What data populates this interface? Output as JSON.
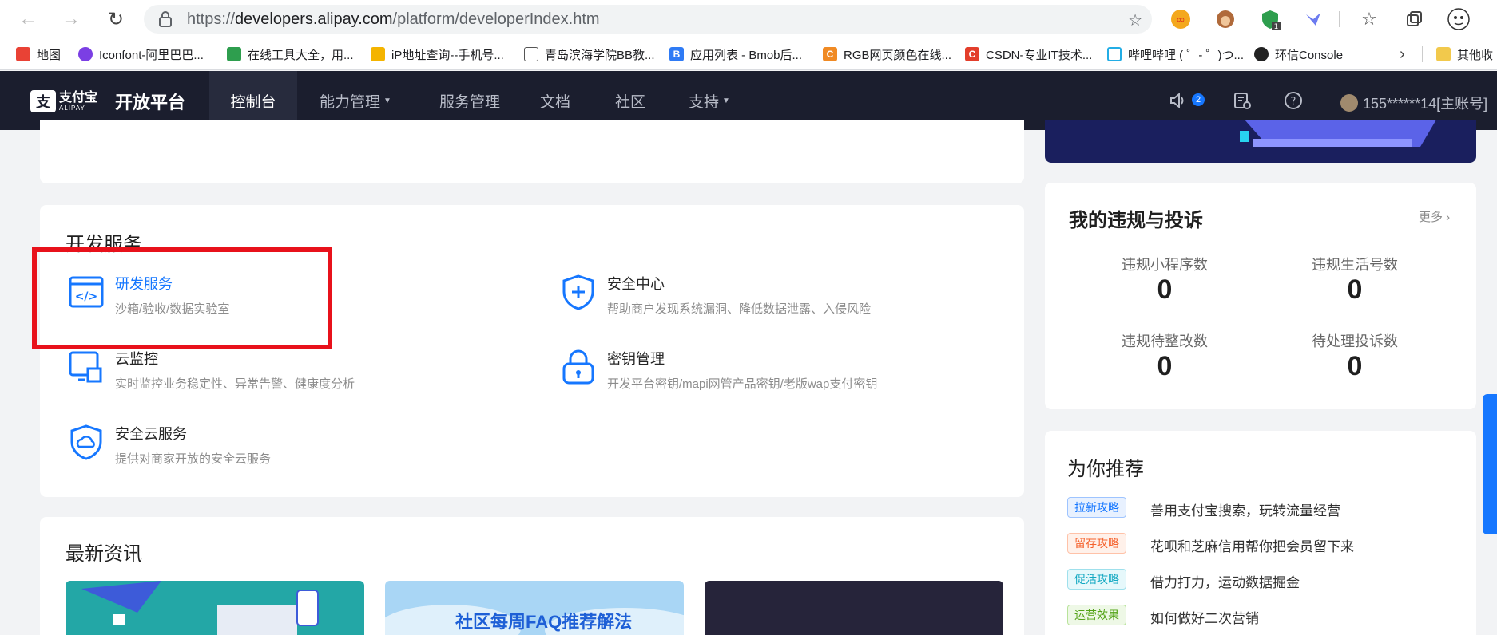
{
  "browser": {
    "url_scheme": "https://",
    "url_host": "developers.alipay.com",
    "url_path": "/platform/developerIndex.htm",
    "ext_badge": "1",
    "bookmarks": [
      {
        "label": "地图",
        "color": "#e94235"
      },
      {
        "label": "Iconfont-阿里巴巴...",
        "color": "#7b3fe4"
      },
      {
        "label": "在线工具大全，用...",
        "color": "#2e9e4e"
      },
      {
        "label": "iP地址查询--手机号...",
        "color": "#f4b400"
      },
      {
        "label": "青岛滨海学院BB教...",
        "color": "#888888"
      },
      {
        "label": "应用列表 - Bmob后...",
        "color": "#2f7bf5"
      },
      {
        "label": "RGB网页颜色在线...",
        "color": "#f08a24"
      },
      {
        "label": "CSDN-专业IT技术...",
        "color": "#e33e2b"
      },
      {
        "label": "哔哩哔哩 ( ゜- ゜)つ...",
        "color": "#23ade5"
      },
      {
        "label": "环信Console",
        "color": "#222222"
      },
      {
        "label": "其他收",
        "color": "#f2c94c"
      }
    ]
  },
  "header": {
    "logo_text": "支付宝",
    "logo_sub": "ALIPAY",
    "platform_title": "开放平台",
    "nav": [
      {
        "label": "控制台",
        "active": true
      },
      {
        "label": "能力管理",
        "caret": true
      },
      {
        "label": "服务管理"
      },
      {
        "label": "文档"
      },
      {
        "label": "社区"
      },
      {
        "label": "支持",
        "caret": true
      }
    ],
    "notification_count": "2",
    "user_label": "155******14[主账号]"
  },
  "dev_services": {
    "title": "开发服务",
    "items": [
      {
        "name": "研发服务",
        "desc": "沙箱/验收/数据实验室",
        "icon": "code-window-icon"
      },
      {
        "name": "安全中心",
        "desc": "帮助商户发现系统漏洞、降低数据泄露、入侵风险",
        "icon": "shield-plus-icon"
      },
      {
        "name": "云监控",
        "desc": "实时监控业务稳定性、异常告警、健康度分析",
        "icon": "monitor-icon"
      },
      {
        "name": "密钥管理",
        "desc": "开发平台密钥/mapi网管产品密钥/老版wap支付密钥",
        "icon": "lock-icon"
      },
      {
        "name": "安全云服务",
        "desc": "提供对商家开放的安全云服务",
        "icon": "shield-cloud-icon"
      }
    ]
  },
  "news": {
    "title": "最新资讯",
    "thumb2_text": "社区每周FAQ推荐解法"
  },
  "violations": {
    "title": "我的违规与投诉",
    "more": "更多",
    "stats": [
      {
        "label": "违规小程序数",
        "value": "0"
      },
      {
        "label": "违规生活号数",
        "value": "0"
      },
      {
        "label": "违规待整改数",
        "value": "0"
      },
      {
        "label": "待处理投诉数",
        "value": "0"
      }
    ]
  },
  "recommend": {
    "title": "为你推荐",
    "items": [
      {
        "tag": "拉新攻略",
        "text": "善用支付宝搜索，玩转流量经营",
        "color": "#1677ff",
        "bg": "#e8f1ff"
      },
      {
        "tag": "留存攻略",
        "text": "花呗和芝麻信用帮你把会员留下来",
        "color": "#f5622d",
        "bg": "#fff1ea"
      },
      {
        "tag": "促活攻略",
        "text": "借力打力，运动数据掘金",
        "color": "#13a8c2",
        "bg": "#e6f8fb"
      },
      {
        "tag": "运营效果",
        "text": "如何做好二次营销",
        "color": "#52a316",
        "bg": "#eef8e6"
      }
    ]
  }
}
